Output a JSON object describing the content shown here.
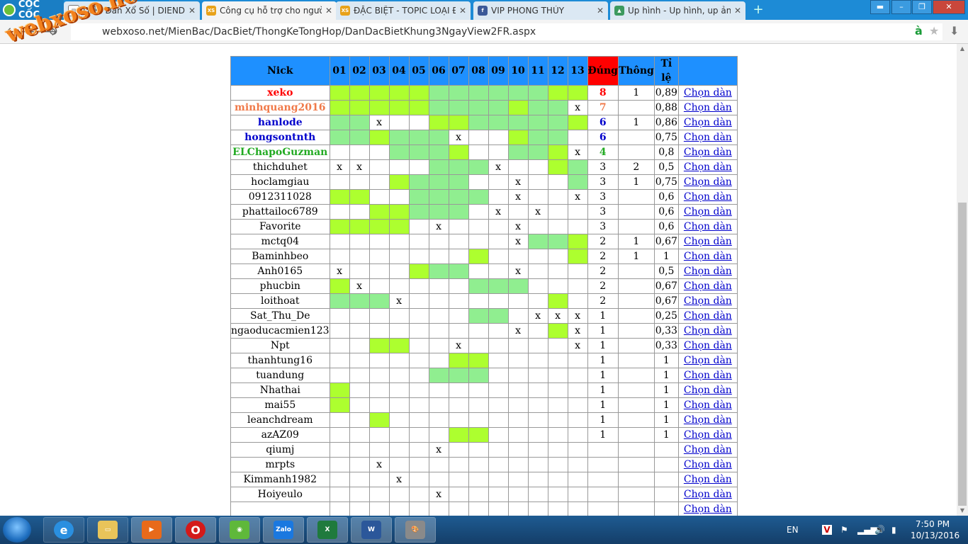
{
  "browser": {
    "brand": "CỐC CỐC",
    "tabs": [
      {
        "title": "Diễn Đàn Xổ Số | DIENDAN",
        "favicon": "document-icon",
        "active": false
      },
      {
        "title": "Công cụ hỗ trợ cho người",
        "favicon": "xoso-icon",
        "active": true
      },
      {
        "title": "ĐẶC BIỆT - TOPIC LOẠI ĐẦ",
        "favicon": "xoso-icon",
        "active": false
      },
      {
        "title": "VIP PHONG THỦY",
        "favicon": "facebook-icon",
        "active": false
      },
      {
        "title": "Up hình - Up hình, up ảnh",
        "favicon": "image-icon",
        "active": false
      }
    ],
    "url_prefix": "webxoso.net",
    "url_path": "/MienBac/DacBiet/ThongKeTongHop/DanDacBietKhung3NgayView2FR.aspx",
    "watermark": "webxoso.net"
  },
  "table": {
    "headers": {
      "nick": "Nick",
      "positions": [
        "01",
        "02",
        "03",
        "04",
        "05",
        "06",
        "07",
        "08",
        "09",
        "10",
        "11",
        "12",
        "13"
      ],
      "dung": "Đúng",
      "thong": "Thông",
      "tile": "Tỉ lệ"
    },
    "link_label": "Chọn dàn",
    "colors": {
      "highlight": "#adff2f",
      "light": "#90ee90",
      "header": "#1e90ff",
      "dung_header": "#ff0000"
    },
    "rows": [
      {
        "nick": "xeko",
        "color": "#ff0000",
        "bold": true,
        "cells": "gggggllllllgg",
        "dung": "8",
        "thong": "1",
        "tile": "0,89"
      },
      {
        "nick": "minhquang2016",
        "color": "#f07a4a",
        "bold": true,
        "cells": "gggggllllgllx",
        "dung": "7",
        "thong": "",
        "tile": "0,88"
      },
      {
        "nick": "hanlode",
        "color": "#0000cc",
        "bold": true,
        "cells": "llx..gglllllg",
        "dung": "6",
        "thong": "1",
        "tile": "0,86"
      },
      {
        "nick": "hongsontnth",
        "color": "#0000cc",
        "bold": true,
        "cells": "llglllx..gll.",
        "dung": "6",
        "thong": "",
        "tile": "0,75"
      },
      {
        "nick": "ELChapoGuzman",
        "color": "#22aa22",
        "bold": true,
        "cells": "...lllg..llgx",
        "dung": "4",
        "thong": "",
        "tile": "0,8"
      },
      {
        "nick": "thichduhet",
        "color": "#000000",
        "bold": false,
        "cells": "xx...lllx..gl",
        "dung": "3",
        "thong": "2",
        "tile": "0,5"
      },
      {
        "nick": "hoclamgiau",
        "color": "#000000",
        "bold": false,
        "cells": "...glll..x..l",
        "dung": "3",
        "thong": "1",
        "tile": "0,75"
      },
      {
        "nick": "0912311028",
        "color": "#000000",
        "bold": false,
        "cells": "gg..llll.x..x",
        "dung": "3",
        "thong": "",
        "tile": "0,6"
      },
      {
        "nick": "phattailoc6789",
        "color": "#000000",
        "bold": false,
        "cells": "..gglll.x.x..",
        "dung": "3",
        "thong": "",
        "tile": "0,6"
      },
      {
        "nick": "Favorite",
        "color": "#000000",
        "bold": false,
        "cells": "gggg.x...x...",
        "dung": "3",
        "thong": "",
        "tile": "0,6"
      },
      {
        "nick": "mctq04",
        "color": "#000000",
        "bold": false,
        "cells": ".........xllg",
        "dung": "2",
        "thong": "1",
        "tile": "0,67"
      },
      {
        "nick": "Baminhbeo",
        "color": "#000000",
        "bold": false,
        "cells": ".......g....g",
        "dung": "2",
        "thong": "1",
        "tile": "1"
      },
      {
        "nick": "Anh0165",
        "color": "#000000",
        "bold": false,
        "cells": "x...gll..x...",
        "dung": "2",
        "thong": "",
        "tile": "0,5"
      },
      {
        "nick": "phucbin",
        "color": "#000000",
        "bold": false,
        "cells": "gx.....lll...",
        "dung": "2",
        "thong": "",
        "tile": "0,67"
      },
      {
        "nick": "loithoat",
        "color": "#000000",
        "bold": false,
        "cells": "lllx.......g.",
        "dung": "2",
        "thong": "",
        "tile": "0,67"
      },
      {
        "nick": "Sat_Thu_De",
        "color": "#000000",
        "bold": false,
        "cells": ".......ll.xxx",
        "dung": "1",
        "thong": "",
        "tile": "0,25"
      },
      {
        "nick": "ngaoducacmien123",
        "color": "#000000",
        "bold": false,
        "cells": ".........x.gx",
        "dung": "1",
        "thong": "",
        "tile": "0,33"
      },
      {
        "nick": "Npt",
        "color": "#000000",
        "bold": false,
        "cells": "..gg..x.....x",
        "dung": "1",
        "thong": "",
        "tile": "0,33"
      },
      {
        "nick": "thanhtung16",
        "color": "#000000",
        "bold": false,
        "cells": "......gg.....",
        "dung": "1",
        "thong": "",
        "tile": "1"
      },
      {
        "nick": "tuandung",
        "color": "#000000",
        "bold": false,
        "cells": ".....lll.....",
        "dung": "1",
        "thong": "",
        "tile": "1"
      },
      {
        "nick": "Nhathai",
        "color": "#000000",
        "bold": false,
        "cells": "g............",
        "dung": "1",
        "thong": "",
        "tile": "1"
      },
      {
        "nick": "mai55",
        "color": "#000000",
        "bold": false,
        "cells": "g............",
        "dung": "1",
        "thong": "",
        "tile": "1"
      },
      {
        "nick": "leanchdream",
        "color": "#000000",
        "bold": false,
        "cells": "..g..........",
        "dung": "1",
        "thong": "",
        "tile": "1"
      },
      {
        "nick": "azAZ09",
        "color": "#000000",
        "bold": false,
        "cells": "......gg.....",
        "dung": "1",
        "thong": "",
        "tile": "1"
      },
      {
        "nick": "qiumj",
        "color": "#000000",
        "bold": false,
        "cells": ".....x.......",
        "dung": "",
        "thong": "",
        "tile": ""
      },
      {
        "nick": "mrpts",
        "color": "#000000",
        "bold": false,
        "cells": "..x..........",
        "dung": "",
        "thong": "",
        "tile": ""
      },
      {
        "nick": "Kimmanh1982",
        "color": "#000000",
        "bold": false,
        "cells": "...x.........",
        "dung": "",
        "thong": "",
        "tile": ""
      },
      {
        "nick": "Hoiyeulo",
        "color": "#000000",
        "bold": false,
        "cells": ".....x.......",
        "dung": "",
        "thong": "",
        "tile": ""
      },
      {
        "nick": "",
        "color": "#000000",
        "bold": false,
        "cells": ".............",
        "dung": "",
        "thong": "",
        "tile": ""
      }
    ]
  },
  "taskbar": {
    "apps": [
      "ie-icon",
      "file-explorer-icon",
      "media-player-icon",
      "opera-icon",
      "coccoc-icon",
      "zalo-icon",
      "excel-icon",
      "word-icon",
      "paint-icon"
    ],
    "language": "EN",
    "time": "7:50 PM",
    "date": "10/13/2016"
  }
}
